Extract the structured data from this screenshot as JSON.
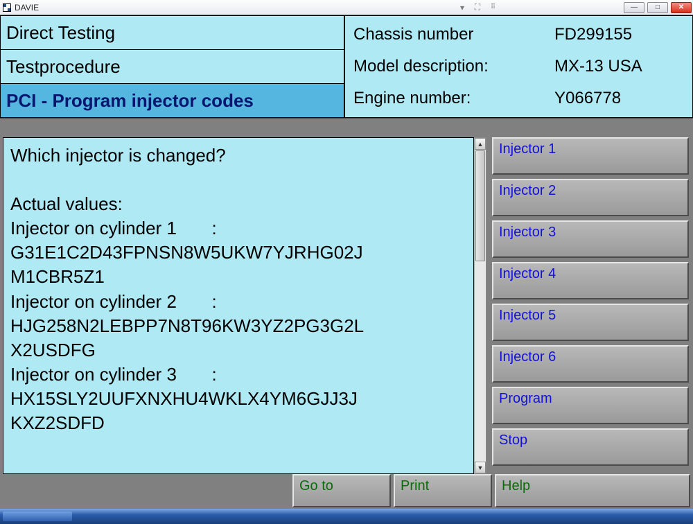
{
  "window": {
    "title": "DAVIE"
  },
  "header": {
    "left": {
      "row1": "Direct Testing",
      "row2": "Testprocedure",
      "row3": "PCI - Program injector codes"
    },
    "right": {
      "chassis_label": "Chassis number",
      "chassis_value": "FD299155",
      "model_label": "Model description:",
      "model_value": "MX-13 USA",
      "engine_label": "Engine number:",
      "engine_value": "Y066778"
    }
  },
  "content": {
    "question": "Which injector is changed?",
    "actual_values_label": "Actual values:",
    "cyl1_label": "Injector on cylinder 1",
    "cyl1_code_l1": "G31E1C2D43FPNSN8W5UKW7YJRHG02J",
    "cyl1_code_l2": "M1CBR5Z1",
    "cyl2_label": "Injector on cylinder 2",
    "cyl2_code_l1": "HJG258N2LEBPP7N8T96KW3YZ2PG3G2L",
    "cyl2_code_l2": "X2USDFG",
    "cyl3_label": "Injector on cylinder 3",
    "cyl3_code_l1": "HX15SLY2UUFXNXHU4WKLX4YM6GJJ3J",
    "cyl3_code_l2": "KXZ2SDFD",
    "colon": ":"
  },
  "side_buttons": {
    "b1": "Injector 1",
    "b2": "Injector 2",
    "b3": "Injector 3",
    "b4": "Injector 4",
    "b5": "Injector 5",
    "b6": "Injector 6",
    "b7": "Program",
    "b8": "Stop"
  },
  "bottom_buttons": {
    "goto": "Go to",
    "print": "Print",
    "help": "Help"
  }
}
